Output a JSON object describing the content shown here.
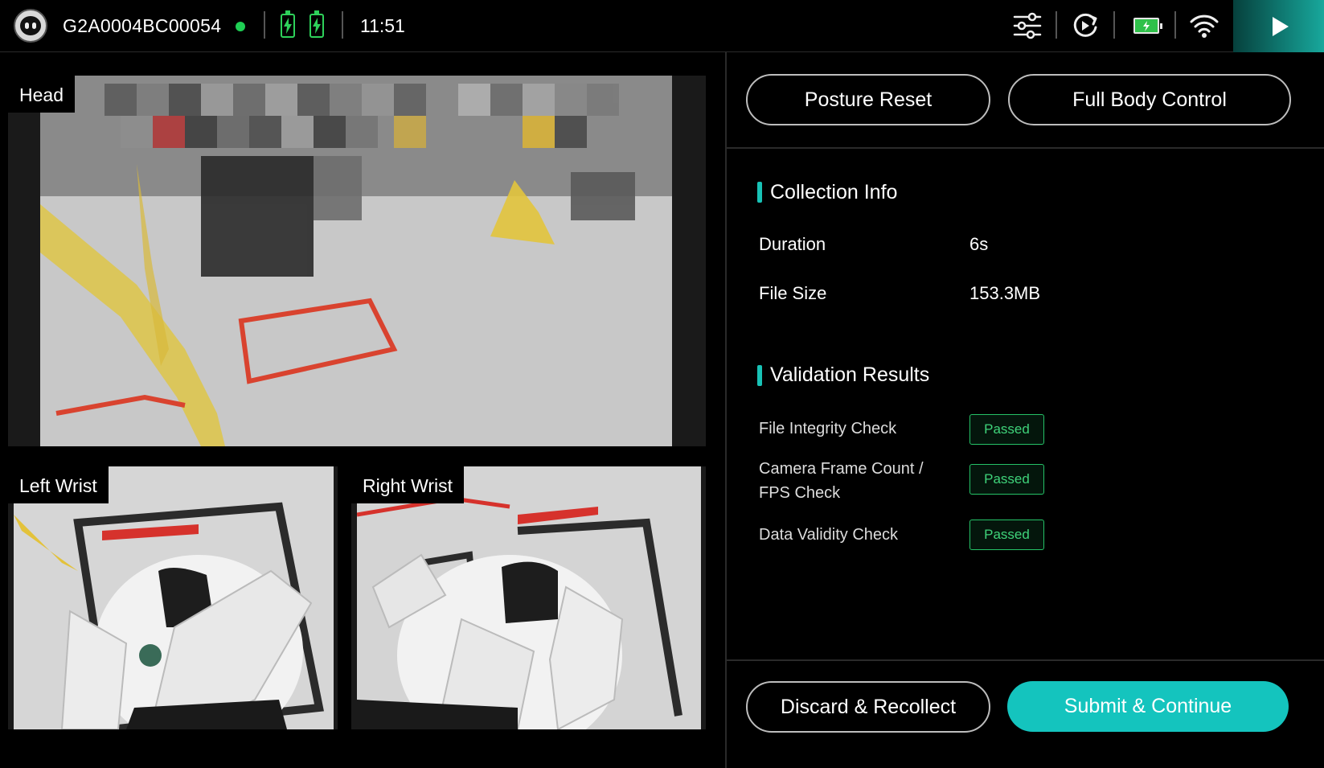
{
  "topbar": {
    "device_id": "G2A0004BC00054",
    "time": "11:51",
    "icons": [
      "robot-avatar",
      "battery-charging-icon",
      "battery-charging-icon",
      "sliders-icon",
      "reset-icon",
      "battery-icon",
      "wifi-icon",
      "play-icon"
    ],
    "accent_color": "#18a89c",
    "status_color": "#1fcf54"
  },
  "cameras": {
    "head": {
      "label": "Head"
    },
    "left_wrist": {
      "label": "Left Wrist"
    },
    "right_wrist": {
      "label": "Right Wrist"
    }
  },
  "actions": {
    "posture_reset": "Posture Reset",
    "full_body_control": "Full Body Control",
    "discard": "Discard & Recollect",
    "submit": "Submit & Continue"
  },
  "collection_info": {
    "title": "Collection Info",
    "rows": [
      {
        "key": "Duration",
        "value": "6s"
      },
      {
        "key": "File Size",
        "value": "153.3MB"
      }
    ]
  },
  "validation": {
    "title": "Validation Results",
    "checks": [
      {
        "label": "File Integrity Check",
        "status": "Passed"
      },
      {
        "label": "Camera Frame Count / FPS Check",
        "status": "Passed"
      },
      {
        "label": "Data Validity Check",
        "status": "Passed"
      }
    ],
    "pass_color": "#25c267"
  },
  "colors": {
    "primary": "#14c4be",
    "background": "#000000"
  }
}
